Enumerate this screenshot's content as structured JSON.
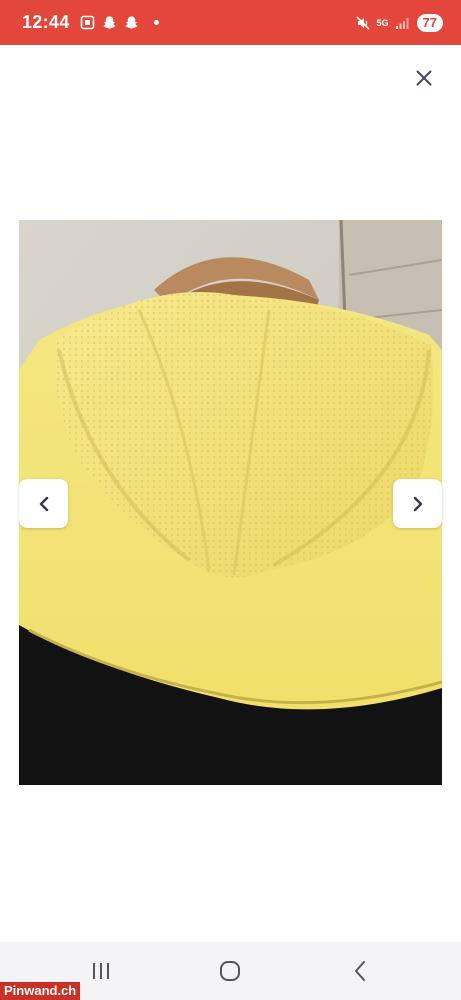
{
  "status_bar": {
    "time": "12:44",
    "network": "5G",
    "battery": "77",
    "background_color": "#e3463a"
  },
  "header": {
    "close_icon": "close-icon"
  },
  "gallery": {
    "image_alt": "yellow hooded jacket with mesh lining on a wooden hanger",
    "prev_icon": "chevron-left-icon",
    "next_icon": "chevron-right-icon"
  },
  "system_nav": {
    "recents_icon": "recents-icon",
    "home_icon": "home-icon",
    "back_icon": "back-icon",
    "background_color": "#f4f4f6"
  },
  "watermark": {
    "text": "Pinwand.ch"
  }
}
